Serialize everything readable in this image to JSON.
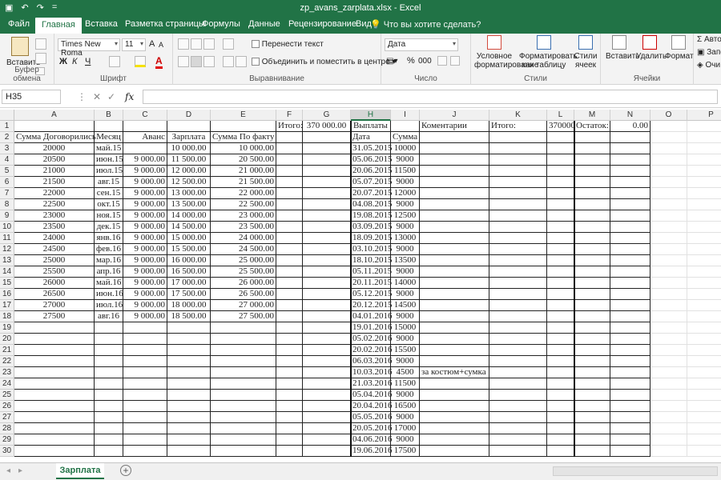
{
  "window": {
    "title": "zp_avans_zarplata.xlsx - Excel",
    "qat": {
      "undo": "↶",
      "redo": "↷",
      "more": "="
    }
  },
  "tabs": [
    "Файл",
    "Главная",
    "Вставка",
    "Разметка страницы",
    "Формулы",
    "Данные",
    "Рецензирование",
    "Вид"
  ],
  "tell_me": "Что вы хотите сделать?",
  "ribbon": {
    "clipboard": {
      "label": "Буфер обмена",
      "paste": "Вставить"
    },
    "font": {
      "label": "Шрифт",
      "name": "Times New Roma",
      "size": "11",
      "bold": "Ж",
      "italic": "К",
      "underline": "Ч",
      "grow": "A",
      "shrink": "A"
    },
    "alignment": {
      "label": "Выравнивание",
      "wrap": "Перенести текст",
      "merge": "Объединить и поместить в центре"
    },
    "number": {
      "label": "Число",
      "format": "Дата",
      "percent": "%",
      "thousands": "000"
    },
    "styles": {
      "label": "Стили",
      "conditional": "Условное форматирование",
      "as_table": "Форматировать как таблицу",
      "cell_styles": "Стили ячеек"
    },
    "cells": {
      "label": "Ячейки",
      "insert": "Вставить",
      "delete": "Удалить",
      "format": "Формат"
    },
    "editing": {
      "autosum": "Авто",
      "fill": "Запо",
      "clear": "Очи"
    }
  },
  "formula_bar": {
    "name_box": "H35",
    "fx": "fx",
    "value": ""
  },
  "columns": [
    "A",
    "B",
    "C",
    "D",
    "E",
    "F",
    "G",
    "H",
    "I",
    "J",
    "K",
    "L",
    "M",
    "N",
    "O",
    "P"
  ],
  "selected_column": "H",
  "rows": [
    [
      "",
      "",
      "",
      "",
      "",
      "Итого:",
      "370 000.00",
      "Выплаты",
      "",
      "Коментарии",
      "Итого:",
      "370000",
      "Остаток:",
      "0.00"
    ],
    [
      "Сумма Договорились",
      "Месяц",
      "Аванс",
      "Зарплата",
      "Сумма По факту",
      "",
      "",
      "Дата",
      "Сумма",
      "",
      "",
      "",
      "",
      ""
    ],
    [
      "20000",
      "май.15",
      "",
      "10 000.00",
      "10 000.00",
      "",
      "",
      "31.05.2015",
      "10000",
      "",
      "",
      "",
      "",
      ""
    ],
    [
      "20500",
      "июн.15",
      "9 000.00",
      "11 500.00",
      "20 500.00",
      "",
      "",
      "05.06.2015",
      "9000",
      "",
      "",
      "",
      "",
      ""
    ],
    [
      "21000",
      "июл.15",
      "9 000.00",
      "12 000.00",
      "21 000.00",
      "",
      "",
      "20.06.2015",
      "11500",
      "",
      "",
      "",
      "",
      ""
    ],
    [
      "21500",
      "авг.15",
      "9 000.00",
      "12 500.00",
      "21 500.00",
      "",
      "",
      "05.07.2015",
      "9000",
      "",
      "",
      "",
      "",
      ""
    ],
    [
      "22000",
      "сен.15",
      "9 000.00",
      "13 000.00",
      "22 000.00",
      "",
      "",
      "20.07.2015",
      "12000",
      "",
      "",
      "",
      "",
      ""
    ],
    [
      "22500",
      "окт.15",
      "9 000.00",
      "13 500.00",
      "22 500.00",
      "",
      "",
      "04.08.2015",
      "9000",
      "",
      "",
      "",
      "",
      ""
    ],
    [
      "23000",
      "ноя.15",
      "9 000.00",
      "14 000.00",
      "23 000.00",
      "",
      "",
      "19.08.2015",
      "12500",
      "",
      "",
      "",
      "",
      ""
    ],
    [
      "23500",
      "дек.15",
      "9 000.00",
      "14 500.00",
      "23 500.00",
      "",
      "",
      "03.09.2015",
      "9000",
      "",
      "",
      "",
      "",
      ""
    ],
    [
      "24000",
      "янв.16",
      "9 000.00",
      "15 000.00",
      "24 000.00",
      "",
      "",
      "18.09.2015",
      "13000",
      "",
      "",
      "",
      "",
      ""
    ],
    [
      "24500",
      "фев.16",
      "9 000.00",
      "15 500.00",
      "24 500.00",
      "",
      "",
      "03.10.2015",
      "9000",
      "",
      "",
      "",
      "",
      ""
    ],
    [
      "25000",
      "мар.16",
      "9 000.00",
      "16 000.00",
      "25 000.00",
      "",
      "",
      "18.10.2015",
      "13500",
      "",
      "",
      "",
      "",
      ""
    ],
    [
      "25500",
      "апр.16",
      "9 000.00",
      "16 500.00",
      "25 500.00",
      "",
      "",
      "05.11.2015",
      "9000",
      "",
      "",
      "",
      "",
      ""
    ],
    [
      "26000",
      "май.16",
      "9 000.00",
      "17 000.00",
      "26 000.00",
      "",
      "",
      "20.11.2015",
      "14000",
      "",
      "",
      "",
      "",
      ""
    ],
    [
      "26500",
      "июн.16",
      "9 000.00",
      "17 500.00",
      "26 500.00",
      "",
      "",
      "05.12.2015",
      "9000",
      "",
      "",
      "",
      "",
      ""
    ],
    [
      "27000",
      "июл.16",
      "9 000.00",
      "18 000.00",
      "27 000.00",
      "",
      "",
      "20.12.2015",
      "14500",
      "",
      "",
      "",
      "",
      ""
    ],
    [
      "27500",
      "авг.16",
      "9 000.00",
      "18 500.00",
      "27 500.00",
      "",
      "",
      "04.01.2016",
      "9000",
      "",
      "",
      "",
      "",
      ""
    ],
    [
      "",
      "",
      "",
      "",
      "",
      "",
      "",
      "19.01.2016",
      "15000",
      "",
      "",
      "",
      "",
      ""
    ],
    [
      "",
      "",
      "",
      "",
      "",
      "",
      "",
      "05.02.2016",
      "9000",
      "",
      "",
      "",
      "",
      ""
    ],
    [
      "",
      "",
      "",
      "",
      "",
      "",
      "",
      "20.02.2016",
      "15500",
      "",
      "",
      "",
      "",
      ""
    ],
    [
      "",
      "",
      "",
      "",
      "",
      "",
      "",
      "06.03.2016",
      "9000",
      "",
      "",
      "",
      "",
      ""
    ],
    [
      "",
      "",
      "",
      "",
      "",
      "",
      "",
      "10.03.2016",
      "4500",
      "за костюм+сумка",
      "",
      "",
      "",
      ""
    ],
    [
      "",
      "",
      "",
      "",
      "",
      "",
      "",
      "21.03.2016",
      "11500",
      "",
      "",
      "",
      "",
      ""
    ],
    [
      "",
      "",
      "",
      "",
      "",
      "",
      "",
      "05.04.2016",
      "9000",
      "",
      "",
      "",
      "",
      ""
    ],
    [
      "",
      "",
      "",
      "",
      "",
      "",
      "",
      "20.04.2016",
      "16500",
      "",
      "",
      "",
      "",
      ""
    ],
    [
      "",
      "",
      "",
      "",
      "",
      "",
      "",
      "05.05.2016",
      "9000",
      "",
      "",
      "",
      "",
      ""
    ],
    [
      "",
      "",
      "",
      "",
      "",
      "",
      "",
      "20.05.2016",
      "17000",
      "",
      "",
      "",
      "",
      ""
    ],
    [
      "",
      "",
      "",
      "",
      "",
      "",
      "",
      "04.06.2016",
      "9000",
      "",
      "",
      "",
      "",
      ""
    ],
    [
      "",
      "",
      "",
      "",
      "",
      "",
      "",
      "19.06.2016",
      "17500",
      "",
      "",
      "",
      "",
      ""
    ]
  ],
  "sheet_tabs": [
    "Зарплата"
  ],
  "add_sheet": "+",
  "colors": {
    "accent": "#217346"
  }
}
